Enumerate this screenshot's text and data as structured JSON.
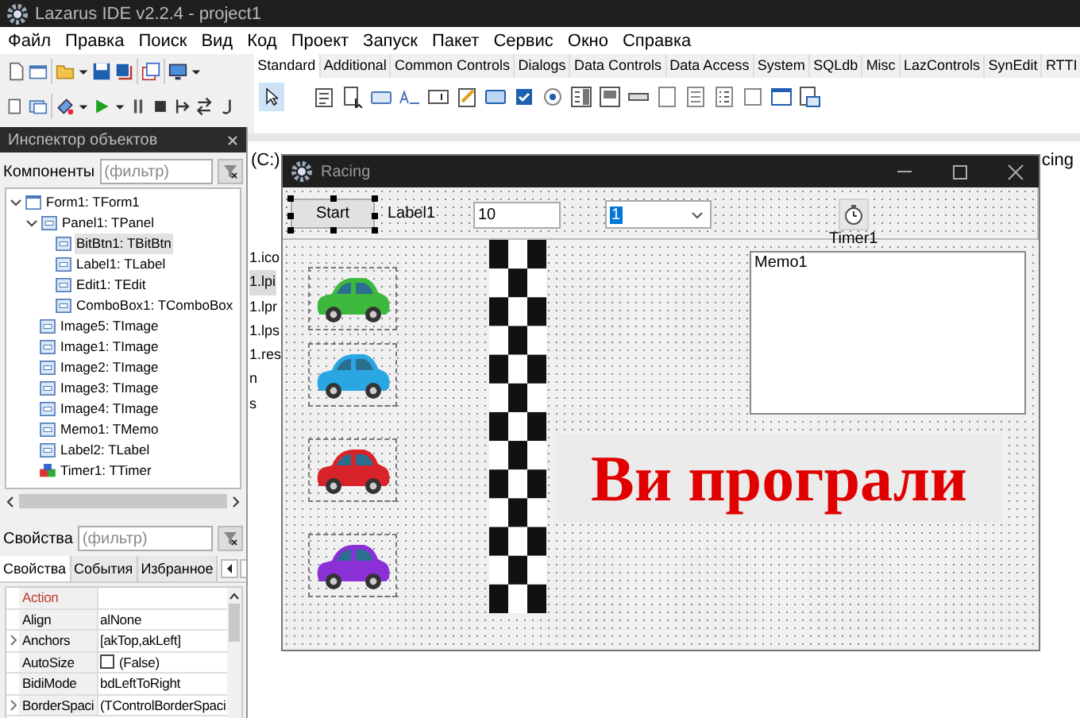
{
  "ide": {
    "title": "Lazarus IDE v2.2.4 - project1",
    "menu": [
      "Файл",
      "Правка",
      "Поиск",
      "Вид",
      "Код",
      "Проект",
      "Запуск",
      "Пакет",
      "Сервис",
      "Окно",
      "Справка"
    ],
    "palette_tabs": [
      {
        "label": "Standard",
        "selected": true
      },
      {
        "label": "Additional",
        "selected": false
      },
      {
        "label": "Common Controls",
        "selected": false
      },
      {
        "label": "Dialogs",
        "selected": false
      },
      {
        "label": "Data Controls",
        "selected": false
      },
      {
        "label": "Data Access",
        "selected": false
      },
      {
        "label": "System",
        "selected": false
      },
      {
        "label": "SQLdb",
        "selected": false
      },
      {
        "label": "Misc",
        "selected": false
      },
      {
        "label": "LazControls",
        "selected": false
      },
      {
        "label": "SynEdit",
        "selected": false
      },
      {
        "label": "RTTI",
        "selected": false
      }
    ]
  },
  "file_pane": {
    "drive": "(C:)",
    "right_text": "cing",
    "files": [
      {
        "name": "1.ico",
        "selected": false
      },
      {
        "name": "1.lpi",
        "selected": true
      },
      {
        "name": "1.lpr",
        "selected": false
      },
      {
        "name": "1.lps",
        "selected": false
      },
      {
        "name": "1.res",
        "selected": false
      },
      {
        "name": "n",
        "selected": false
      },
      {
        "name": "s",
        "selected": false
      }
    ]
  },
  "inspector": {
    "title": "Инспектор объектов",
    "components_label": "Компоненты",
    "components_filter": {
      "placeholder": "(фильтр)"
    },
    "tree": [
      {
        "label": "Form1: TForm1",
        "kind": "form",
        "expanded": true,
        "selected": false,
        "children": [
          {
            "label": "Panel1: TPanel",
            "kind": "control",
            "expanded": true,
            "selected": false,
            "children": [
              {
                "label": "BitBtn1: TBitBtn",
                "kind": "control",
                "selected": true
              },
              {
                "label": "Label1: TLabel",
                "kind": "control",
                "selected": false
              },
              {
                "label": "Edit1: TEdit",
                "kind": "control",
                "selected": false
              },
              {
                "label": "ComboBox1: TComboBox",
                "kind": "control",
                "selected": false
              }
            ]
          },
          {
            "label": "Image5: TImage",
            "kind": "control",
            "selected": false
          },
          {
            "label": "Image1: TImage",
            "kind": "control",
            "selected": false
          },
          {
            "label": "Image2: TImage",
            "kind": "control",
            "selected": false
          },
          {
            "label": "Image3: TImage",
            "kind": "control",
            "selected": false
          },
          {
            "label": "Image4: TImage",
            "kind": "control",
            "selected": false
          },
          {
            "label": "Memo1: TMemo",
            "kind": "control",
            "selected": false
          },
          {
            "label": "Label2: TLabel",
            "kind": "control",
            "selected": false
          },
          {
            "label": "Timer1: TTimer",
            "kind": "timer",
            "selected": false
          }
        ]
      }
    ],
    "properties_label": "Свойства",
    "properties_filter": {
      "placeholder": "(фильтр)"
    },
    "tabs": [
      {
        "label": "Свойства",
        "selected": true
      },
      {
        "label": "События",
        "selected": false
      },
      {
        "label": "Избранное",
        "selected": false
      }
    ],
    "properties": [
      {
        "name": "Action",
        "kind": "reference",
        "expandable": false
      },
      {
        "name": "Align",
        "value": "alNone",
        "kind": "text",
        "expandable": false
      },
      {
        "name": "Anchors",
        "value": "[akTop,akLeft]",
        "kind": "text",
        "expandable": true
      },
      {
        "name": "AutoSize",
        "value": "(False)",
        "kind": "checkbox",
        "checked": false,
        "expandable": false
      },
      {
        "name": "BidiMode",
        "value": "bdLeftToRight",
        "kind": "text",
        "expandable": false
      },
      {
        "name": "BorderSpaci",
        "value": "(TControlBorderSpaci",
        "kind": "text",
        "expandable": true
      }
    ]
  },
  "form": {
    "title": "Racing",
    "start_button": "Start",
    "label1": "Label1",
    "edit_value": "10",
    "combo_value": "1",
    "timer_label": "Timer1",
    "memo_text": "Memo1",
    "cars": [
      {
        "color": "#3cb93c"
      },
      {
        "color": "#2aa7e2"
      },
      {
        "color": "#d8232a"
      },
      {
        "color": "#8b2fd6"
      }
    ],
    "result_label": "Ви програли"
  }
}
